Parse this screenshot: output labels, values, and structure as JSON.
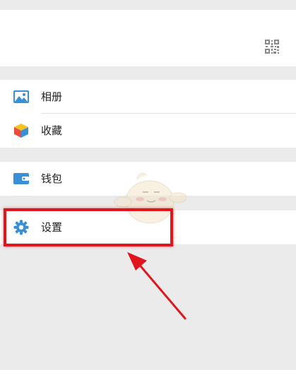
{
  "colors": {
    "background": "#ebebeb",
    "card": "#ffffff",
    "text": "#222222",
    "highlight": "#e0161e",
    "icon_blue": "#3a90d6"
  },
  "menu": {
    "album": {
      "label": "相册",
      "icon": "picture-icon"
    },
    "favorites": {
      "label": "收藏",
      "icon": "cube-icon"
    },
    "wallet": {
      "label": "钱包",
      "icon": "wallet-icon"
    },
    "settings": {
      "label": "设置",
      "icon": "gear-icon"
    }
  },
  "overlay": {
    "highlight": "settings",
    "arrow_icon": "red-arrow-icon",
    "watermark_icon": "mascot-watermark-icon"
  }
}
